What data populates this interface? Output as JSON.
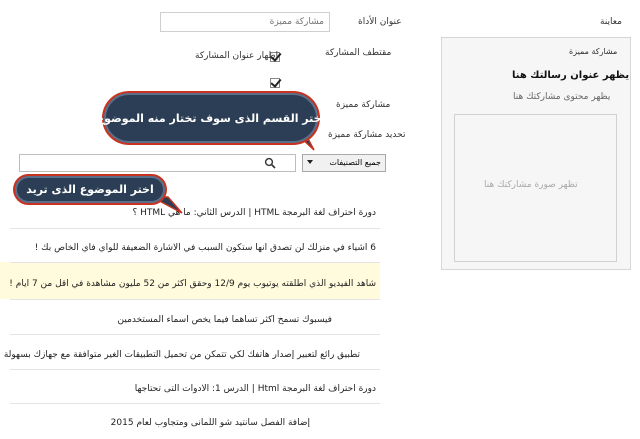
{
  "form": {
    "title_label": "عنوان الأداة",
    "title_placeholder": "مشاركة مميزة",
    "options_label": "مقتطف المشاركة",
    "show_title_label": "إظهار عنوان المشاركة",
    "featured_post_label": "مشاركة مميزة",
    "select_post_label": "تحديد مشاركة مميزة",
    "category_select_value": "جميع التصنيفات"
  },
  "preview": {
    "heading": "معاينة",
    "box_label": "مشاركة مميزة",
    "post_title": "يظهر عنوان رسالتك هنا",
    "post_content": "يظهر محتوى مشاركتك هنا",
    "image_placeholder": "تظهر صورة مشاركتك هنا"
  },
  "callouts": {
    "choose_section": "اختر القسم الذى سوف تختار منه الموضوع",
    "choose_topic": "اختر الموضوع الذى تريد"
  },
  "posts": [
    "دورة احتراف لغة البرمجة HTML | الدرس الثاني: ما هي HTML ؟",
    "6 أشياء في منزلك لن تصدق انها ستكون السبب في الاشارة الضعيفة للواي فاي الخاص بك !",
    "شاهد الفيديو الذي أطلقته يوتيوب يوم 12/9 وحقق أكثر من 52 مليون مشاهدة في أقل من 7 أيام !",
    "فيسبوك تسمح أكثر تساهماً فيما يخص أسماء المستخدمين",
    "تطبيق رائع لتعبير إصدار هاتفك لكي تتمكن من تحميل التطبيقات الغير متوافقة مع جهازك بسهولة",
    "دورة احتراف لغة البرمجة Html | الدرس 1: الادوات التى تحتاجها",
    "إضافة الفصل سانتيد شو اللمانى ومتجاوب لعام 2015"
  ]
}
